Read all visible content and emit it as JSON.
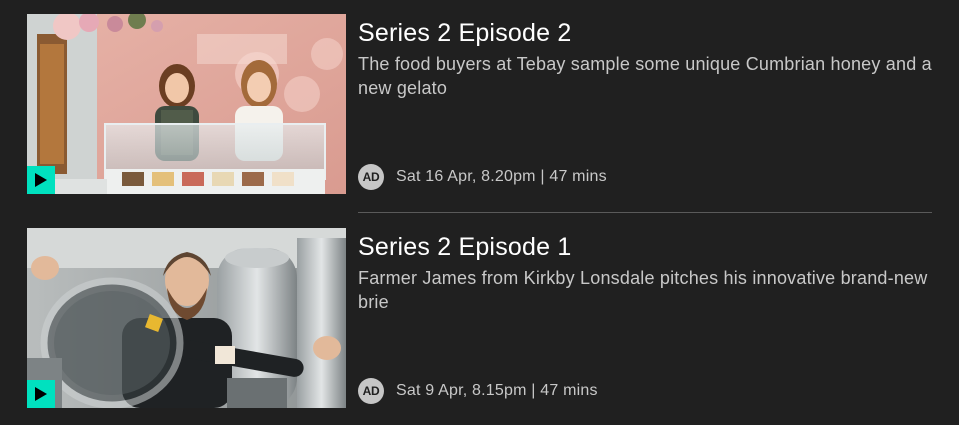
{
  "episodes": [
    {
      "title": "Series 2 Episode 2",
      "description": "The food buyers at Tebay sample some unique Cumbrian honey and a new gelato",
      "audio_description_badge": "AD",
      "broadcast": "Sat 16 Apr, 8.20pm | 47 mins",
      "thumbnail_icon": "two-women-at-gelato-counter-image",
      "play_icon": "play-icon"
    },
    {
      "title": "Series 2 Episode 1",
      "description": "Farmer James from Kirkby Lonsdale pitches his innovative brand-new brie",
      "audio_description_badge": "AD",
      "broadcast": "Sat 9 Apr, 8.15pm | 47 mins",
      "thumbnail_icon": "man-with-cheese-vat-image",
      "play_icon": "play-icon"
    }
  ],
  "colors": {
    "background": "#202020",
    "accent_play": "#00e1bf",
    "title": "#ffffff",
    "secondary_text": "#c8c8c8",
    "divider": "#5a5a5a"
  }
}
